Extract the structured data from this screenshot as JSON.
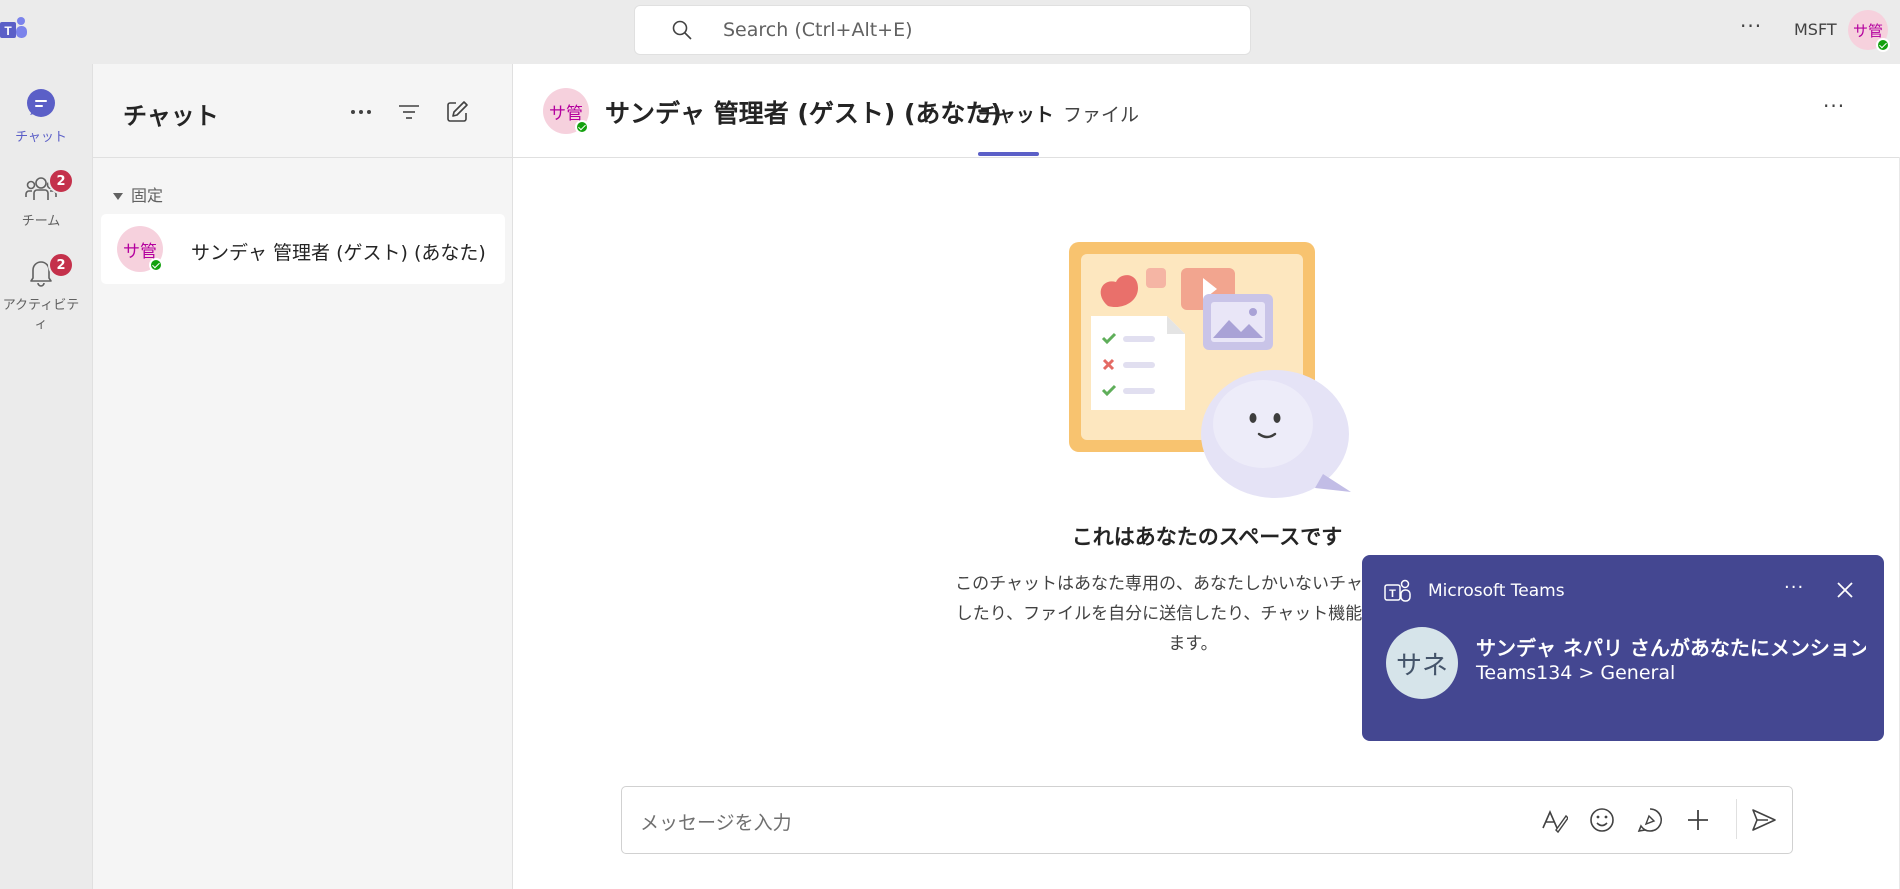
{
  "titlebar": {
    "search_placeholder": "Search (Ctrl+Alt+E)",
    "more": "···",
    "org": "MSFT",
    "avatar_initials": "サ管"
  },
  "rail": [
    {
      "label": "チャット",
      "icon": "chat-icon",
      "active": true
    },
    {
      "label": "チーム",
      "icon": "teams-icon",
      "badge": "2"
    },
    {
      "label": "アクティビティ",
      "icon": "bell-icon",
      "badge": "2"
    }
  ],
  "chat_list": {
    "title": "チャット",
    "section": "固定",
    "items": [
      {
        "initials": "サ管",
        "name": "サンデャ 管理者 (ゲスト) (あなた)"
      }
    ]
  },
  "conversation": {
    "initials": "サ管",
    "name": "サンデャ 管理者 (ゲスト) (あなた)",
    "tabs": [
      "チャット",
      "ファイル"
    ],
    "empty_title": "これはあなたのスペースです",
    "empty_desc": "このチャットはあなた専用の、あなたしかいないチャットです\nしたり、ファイルを自分に送信したり、チャット機能にもっと\nます。",
    "composer_placeholder": "メッセージを入力"
  },
  "toast": {
    "app": "Microsoft Teams",
    "avatar": "サネ",
    "title": "サンデャ ネパリ さんがあなたにメンションし...",
    "subtitle": "Teams134 > General"
  },
  "colors": {
    "accent": "#5b5fc7",
    "toast_bg": "#444791",
    "presence": "#13a10e",
    "badge": "#c4314b"
  }
}
